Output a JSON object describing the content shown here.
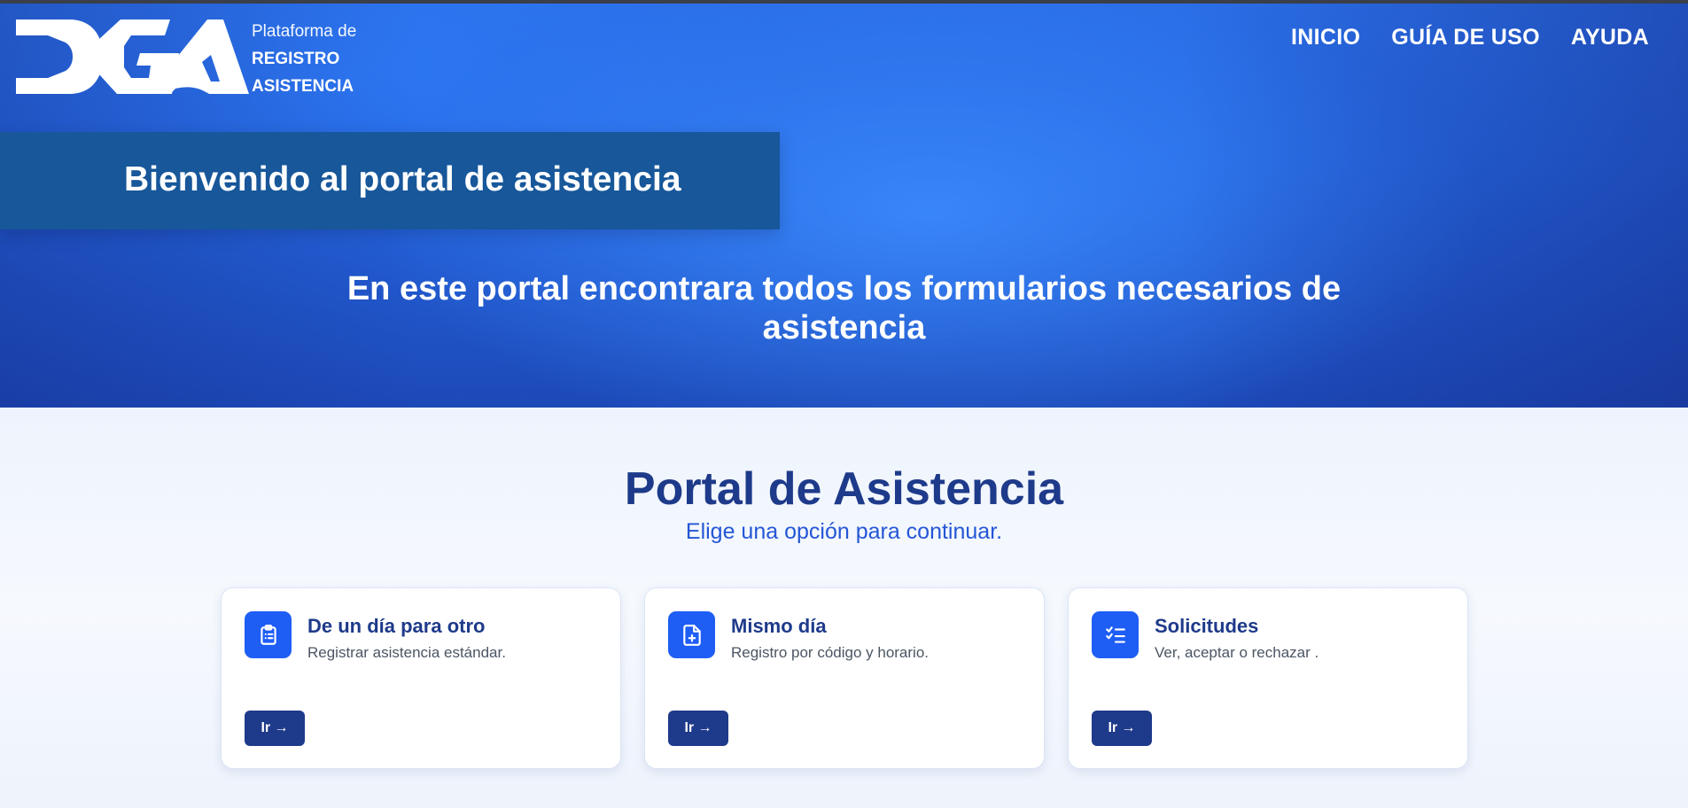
{
  "brand": {
    "subtitle": "Plataforma de",
    "line1": "REGISTRO",
    "line2": "ASISTENCIA",
    "logo_text": "DGA"
  },
  "nav": {
    "items": [
      {
        "label": "INICIO"
      },
      {
        "label": "GUÍA DE USO"
      },
      {
        "label": "AYUDA"
      }
    ]
  },
  "hero": {
    "welcome": "Bienvenido al portal de asistencia",
    "description": "En este portal encontrara todos los formularios necesarios de asistencia"
  },
  "portal": {
    "title": "Portal de Asistencia",
    "subtitle": "Elige una opción para continuar."
  },
  "cards": [
    {
      "title": "De un día para otro",
      "description": "Registrar asistencia estándar.",
      "button": "Ir →",
      "icon": "clipboard-list-icon"
    },
    {
      "title": "Mismo día",
      "description": "Registro por código y horario.",
      "button": "Ir →",
      "icon": "file-plus-icon"
    },
    {
      "title": "Solicitudes",
      "description": "Ver, aceptar o rechazar .",
      "button": "Ir →",
      "icon": "checklist-icon"
    }
  ],
  "colors": {
    "hero_blue": "#2b6fe8",
    "welcome_band": "#17579a",
    "navy": "#1e3a8a",
    "accent": "#1e5ef5",
    "subtitle_blue": "#2456d6"
  }
}
